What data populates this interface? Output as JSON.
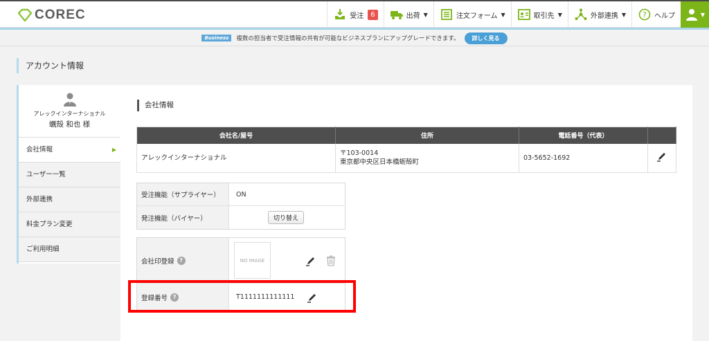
{
  "header": {
    "logo_text": "COREC",
    "nav": {
      "orders_received": "受注",
      "orders_count": "6",
      "shipments": "出荷",
      "order_forms": "注文フォーム",
      "partners": "取引先",
      "integrations": "外部連携",
      "help": "ヘルプ"
    },
    "caret": "▼"
  },
  "announcement": {
    "badge": "Business",
    "text": "複数の担当者で受注情報の共有が可能なビジネスプランにアップグレードできます。",
    "button": "詳しく見る"
  },
  "page_title": "アカウント情報",
  "sidebar": {
    "company": "アレックインターナショナル",
    "user": "蠣殻 和也 様",
    "items": [
      {
        "label": "会社情報"
      },
      {
        "label": "ユーザー一覧"
      },
      {
        "label": "外部連携"
      },
      {
        "label": "料金プラン変更"
      },
      {
        "label": "ご利用明細"
      }
    ]
  },
  "main": {
    "section_title": "会社情報",
    "table": {
      "headers": [
        "会社名/屋号",
        "住所",
        "電話番号（代表）"
      ],
      "company_name": "アレックインターナショナル",
      "postal": "〒103-0014",
      "address": "東京都中央区日本橋蛎殻町",
      "phone": "03-5652-1692"
    },
    "functions": {
      "supplier_label": "受注機能（サプライヤー）",
      "supplier_value": "ON",
      "buyer_label": "発注機能（バイヤー）",
      "toggle_button": "切り替え"
    },
    "seal": {
      "label": "会社印登録",
      "placeholder": "NO IMAGE"
    },
    "registration": {
      "label": "登録番号",
      "value": "T1111111111111"
    }
  },
  "colors": {
    "accent_green": "#7cb518",
    "accent_blue": "#4a9fd6",
    "highlight_red": "#ff0000",
    "badge_red": "#e8534f"
  }
}
